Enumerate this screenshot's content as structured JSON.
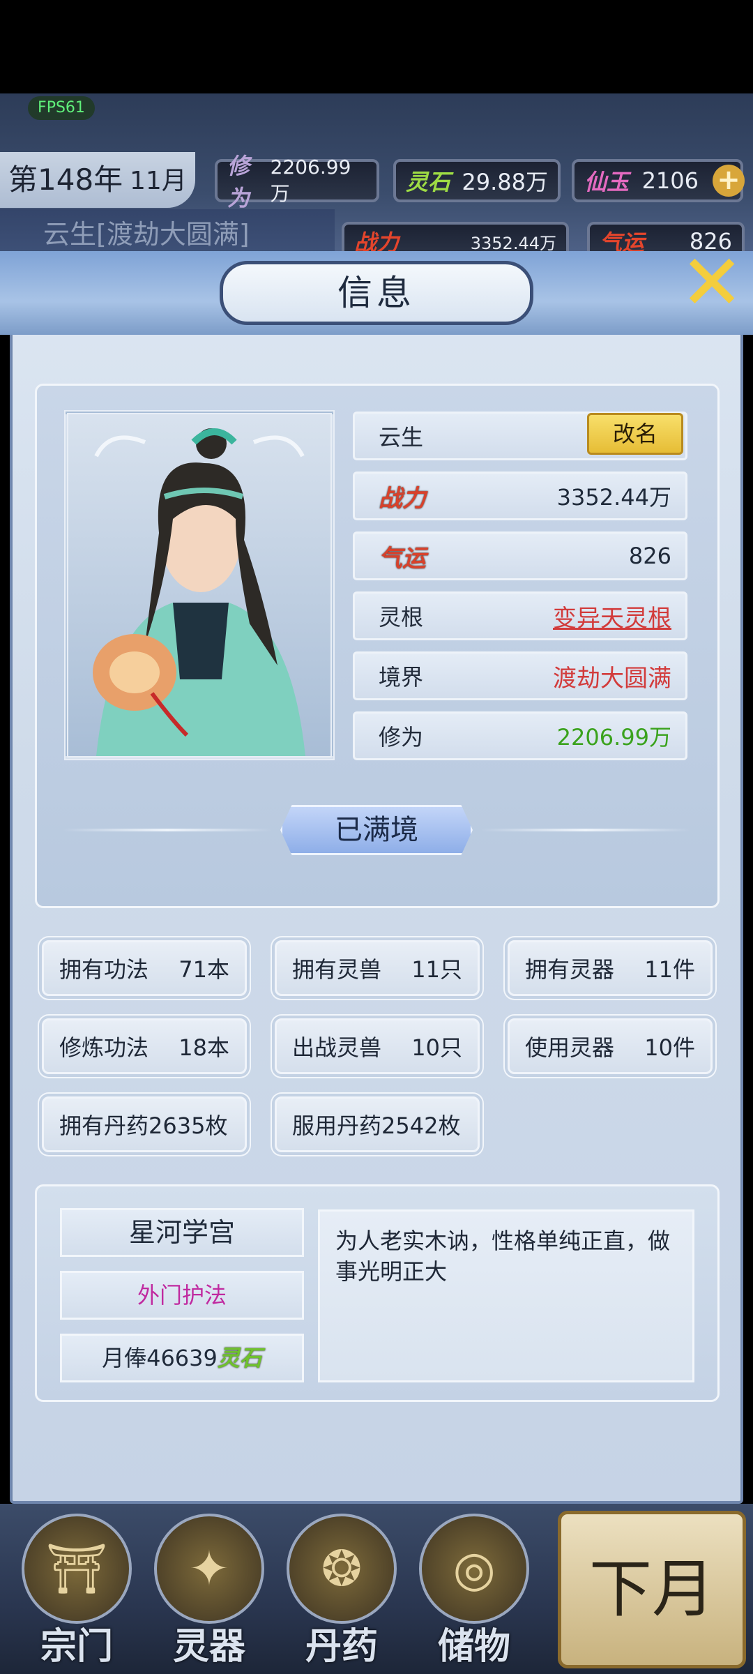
{
  "status": {
    "fps": "FPS61"
  },
  "hud": {
    "year": "第148年",
    "month": "11月",
    "cultivation_label": "修为",
    "cultivation_value": "2206.99万",
    "spirit_stone_label": "灵石",
    "spirit_stone_value": "29.88万",
    "jade_label": "仙玉",
    "jade_value": "2106",
    "character_title": "云生[渡劫大圆满]",
    "power_label": "战力",
    "power_value": "3352.44万",
    "luck_label": "气运",
    "luck_value": "826"
  },
  "dialog": {
    "title": "信息",
    "name": "云生",
    "rename_label": "改名",
    "power_label": "战力",
    "power_value": "3352.44万",
    "luck_label": "气运",
    "luck_value": "826",
    "root_label": "灵根",
    "root_value": "变异天灵根",
    "realm_label": "境界",
    "realm_value": "渡劫大圆满",
    "cultivation_label": "修为",
    "cultivation_value": "2206.99万",
    "realm_status": "已满境"
  },
  "stats": [
    {
      "label": "拥有功法",
      "value": "71本"
    },
    {
      "label": "拥有灵兽",
      "value": "11只"
    },
    {
      "label": "拥有灵器",
      "value": "11件"
    },
    {
      "label": "修炼功法",
      "value": "18本"
    },
    {
      "label": "出战灵兽",
      "value": "10只"
    },
    {
      "label": "使用灵器",
      "value": "10件"
    },
    {
      "label": "拥有丹药2635枚",
      "value": ""
    },
    {
      "label": "服用丹药2542枚",
      "value": ""
    }
  ],
  "sect": {
    "name": "星河学宫",
    "position": "外门护法",
    "salary_prefix": "月俸46639",
    "salary_unit": "灵石",
    "description": "为人老实木讷，性格单纯正直，做事光明正大"
  },
  "nav": {
    "items": [
      "宗门",
      "灵器",
      "丹药",
      "储物"
    ],
    "next_month": "下月"
  },
  "colors": {
    "rename_button": "#e6bd36",
    "root_value": "#d23b3b",
    "realm_value": "#d23b3b",
    "cultivation_value": "#3aa21c",
    "position": "#c02aa0",
    "close_icon": "#f4cd3c"
  }
}
